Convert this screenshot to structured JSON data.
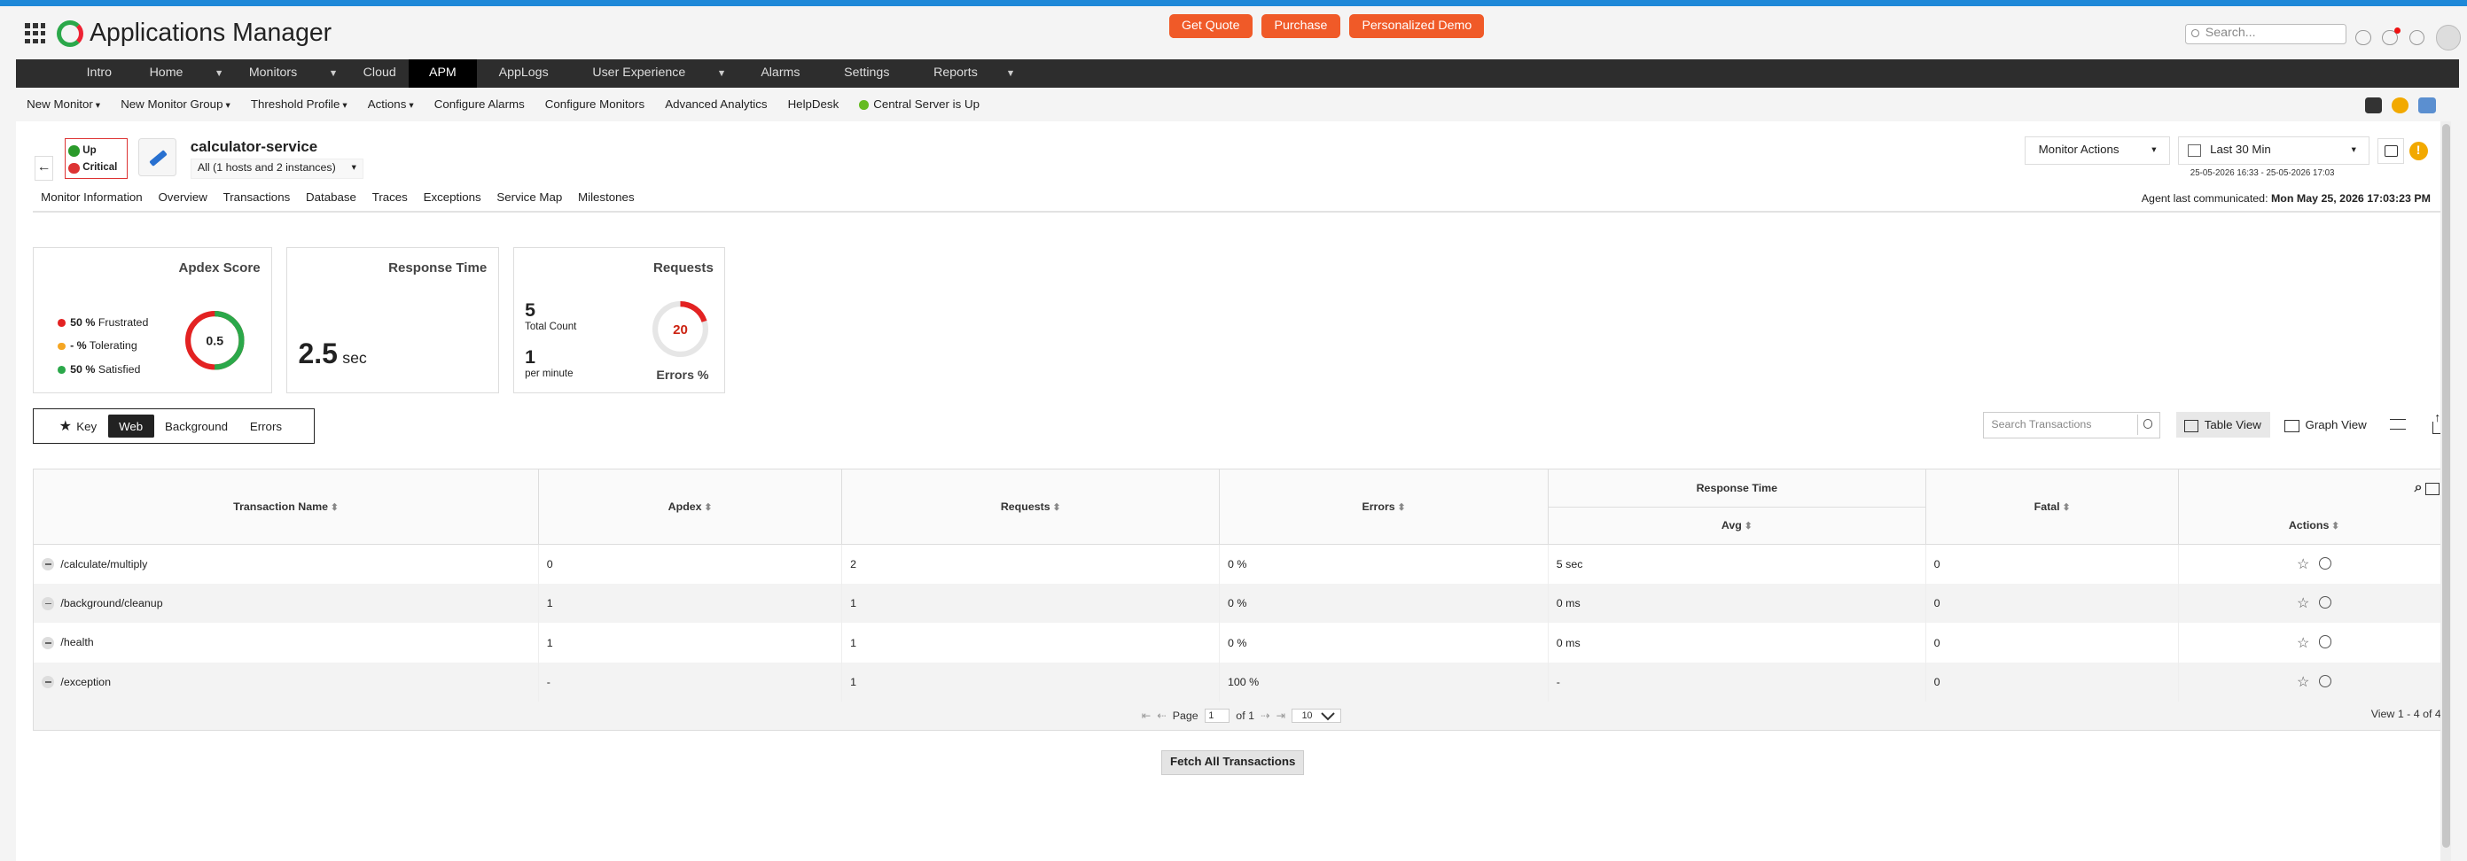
{
  "app": {
    "title": "Applications Manager"
  },
  "header": {
    "buttons": [
      "Get Quote",
      "Purchase",
      "Personalized Demo"
    ],
    "search_placeholder": "Search..."
  },
  "nav": {
    "items": [
      {
        "label": "Intro"
      },
      {
        "label": "Home"
      },
      {
        "label": "Monitors"
      },
      {
        "label": "Cloud"
      },
      {
        "label": "APM"
      },
      {
        "label": "AppLogs"
      },
      {
        "label": "User Experience"
      },
      {
        "label": "Alarms"
      },
      {
        "label": "Settings"
      },
      {
        "label": "Reports"
      }
    ],
    "active": "APM"
  },
  "subnav": {
    "items": [
      "New Monitor",
      "New Monitor Group",
      "Threshold Profile",
      "Actions",
      "Configure Alarms",
      "Configure Monitors",
      "Advanced Analytics",
      "HelpDesk"
    ],
    "server_status": "Central Server is Up"
  },
  "monitor": {
    "status_up": "Up",
    "status_critical": "Critical",
    "name": "calculator-service",
    "host_selector": "All (1 hosts and 2 instances)",
    "actions_label": "Monitor Actions",
    "period_label": "Last 30 Min",
    "date_range": "25-05-2026 16:33 - 25-05-2026 17:03",
    "agent_label": "Agent last communicated:",
    "agent_time": "Mon May 25, 2026 17:03:23 PM"
  },
  "tabs": [
    "Monitor Information",
    "Overview",
    "Transactions",
    "Database",
    "Traces",
    "Exceptions",
    "Service Map",
    "Milestones"
  ],
  "active_tab": "Transactions",
  "apdex": {
    "title": "Apdex Score",
    "score": "0.5",
    "frustrated_pct": "50 %",
    "frustrated_label": "Frustrated",
    "tolerating_pct": "- %",
    "tolerating_label": "Tolerating",
    "satisfied_pct": "50 %",
    "satisfied_label": "Satisfied",
    "colors": {
      "frustrated": "#e32222",
      "tolerating": "#f5a623",
      "satisfied": "#2ba84a"
    }
  },
  "response_time": {
    "title": "Response Time",
    "value": "2.5",
    "unit": "sec"
  },
  "requests": {
    "title": "Requests",
    "total": "5",
    "total_label": "Total Count",
    "rate": "1",
    "rate_label": "per minute",
    "errors_pct": "20",
    "errors_label": "Errors %",
    "errors_fraction": 0.2
  },
  "filters": {
    "items": [
      "Key",
      "Web",
      "Background",
      "Errors"
    ],
    "active": "Web"
  },
  "toolbar": {
    "search_placeholder": "Search Transactions",
    "table_view": "Table View",
    "graph_view": "Graph View"
  },
  "table": {
    "headers": {
      "name": "Transaction Name",
      "apdex": "Apdex",
      "requests": "Requests",
      "errors": "Errors",
      "response_time": "Response Time",
      "avg": "Avg",
      "fatal": "Fatal",
      "actions": "Actions"
    },
    "rows": [
      {
        "name": "/calculate/multiply",
        "apdex": "0",
        "requests": "2",
        "errors": "0 %",
        "avg": "5 sec",
        "fatal": "0"
      },
      {
        "name": "/background/cleanup",
        "apdex": "1",
        "requests": "1",
        "errors": "0 %",
        "avg": "0 ms",
        "fatal": "0"
      },
      {
        "name": "/health",
        "apdex": "1",
        "requests": "1",
        "errors": "0 %",
        "avg": "0 ms",
        "fatal": "0"
      },
      {
        "name": "/exception",
        "apdex": "-",
        "requests": "1",
        "errors": "100 %",
        "avg": "-",
        "fatal": "0"
      }
    ],
    "pager": {
      "page_label": "Page",
      "page": "1",
      "of_label": "of 1",
      "page_size": "10",
      "view_info": "View 1 - 4 of 4"
    }
  },
  "fetch_label": "Fetch All Transactions"
}
